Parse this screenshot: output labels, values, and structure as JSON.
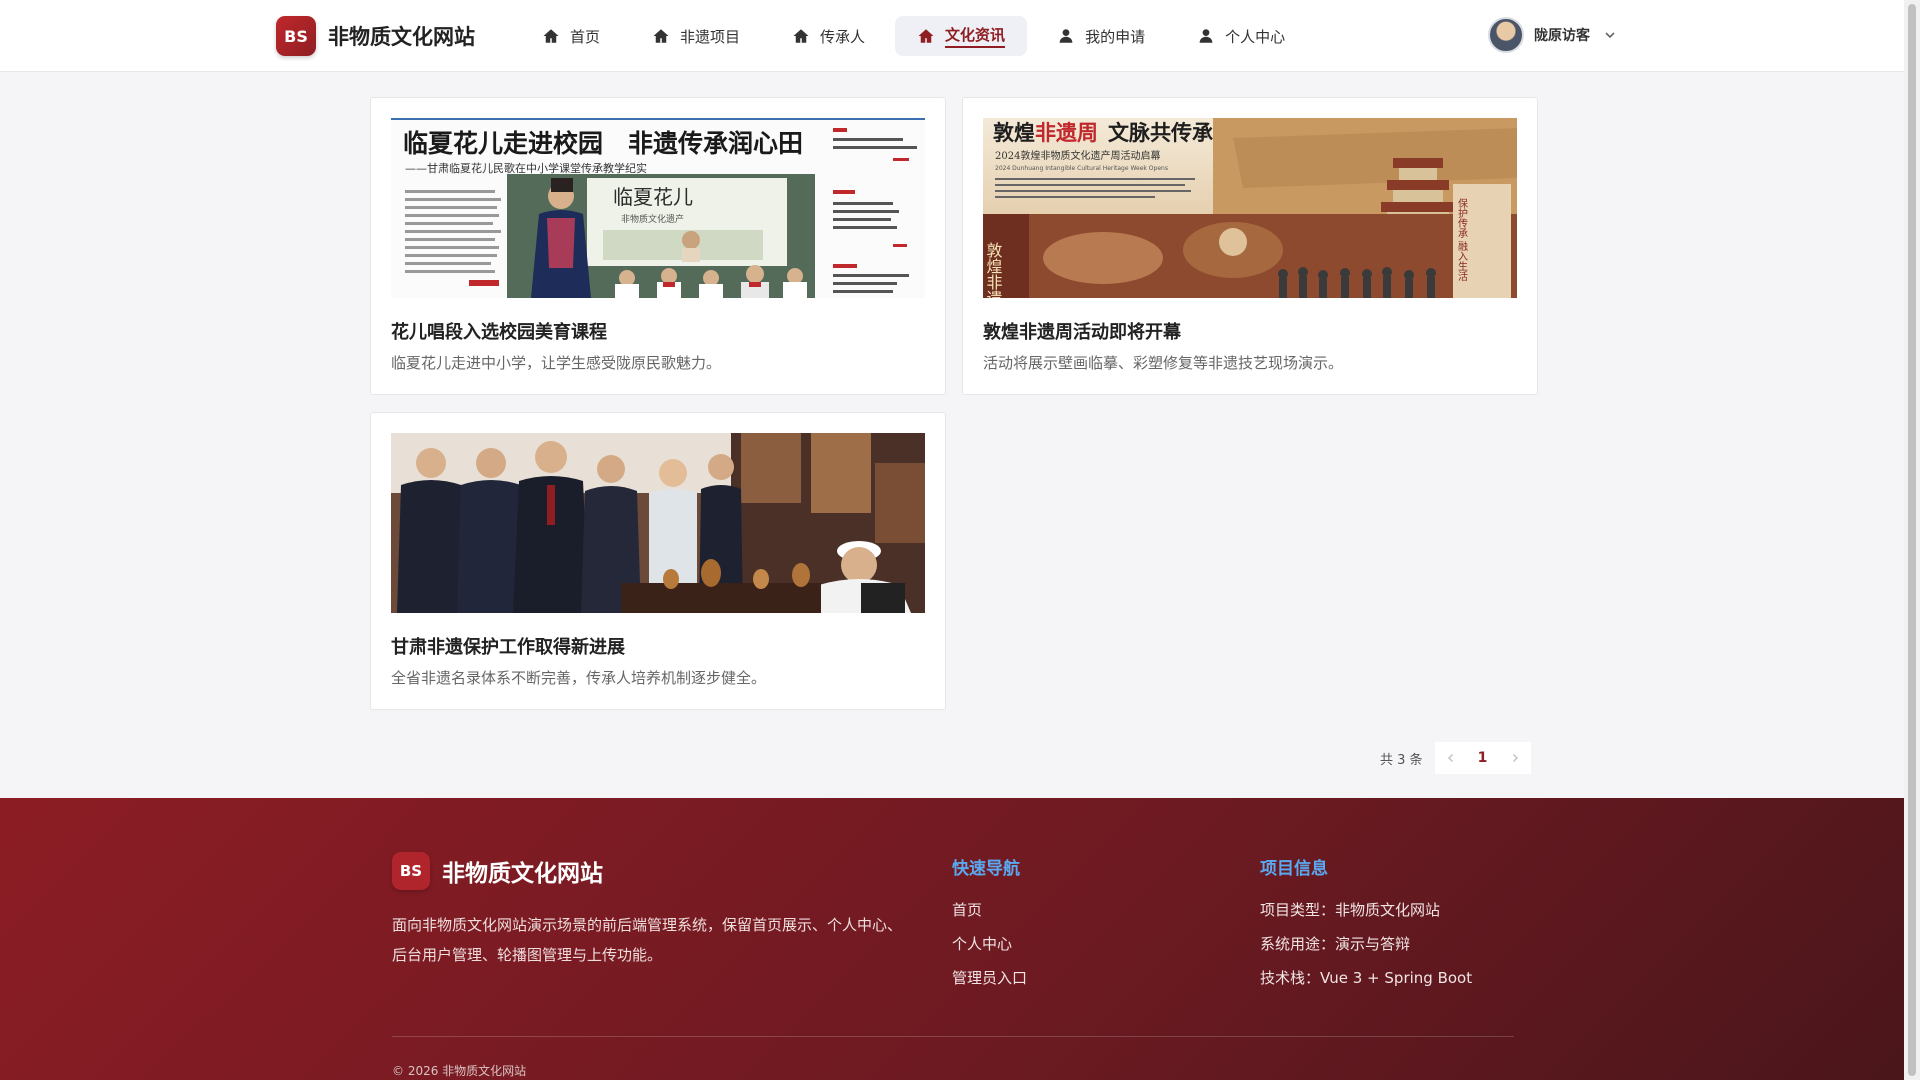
{
  "brand": {
    "badge": "BS",
    "name": "非物质文化网站",
    "accent": "#8e1e22"
  },
  "nav": {
    "items": [
      {
        "label": "首页",
        "icon": "home-icon",
        "active": false
      },
      {
        "label": "非遗项目",
        "icon": "home-icon",
        "active": false
      },
      {
        "label": "传承人",
        "icon": "home-icon",
        "active": false
      },
      {
        "label": "文化资讯",
        "icon": "home-icon",
        "active": true
      },
      {
        "label": "我的申请",
        "icon": "user-icon",
        "active": false
      },
      {
        "label": "个人中心",
        "icon": "user-icon",
        "active": false
      }
    ]
  },
  "user": {
    "name": "陇原访客",
    "icon": "chevron-down-icon"
  },
  "news": [
    {
      "title": "花儿唱段入选校园美育课程",
      "desc": "临夏花儿走进中小学，让学生感受陇原民歌魅力。",
      "image": {
        "headline": "临夏花儿走进校园　非遗传承润心田",
        "subheadline": "——甘肃临夏花儿民歌在中小学课堂传承教学纪实",
        "board_text": "临夏花儿",
        "board_sub": "非物质文化遗产"
      }
    },
    {
      "title": "敦煌非遗周活动即将开幕",
      "desc": "活动将展示壁画临摹、彩塑修复等非遗技艺现场演示。",
      "image": {
        "headline_prefix": "敦煌",
        "headline_highlight": "非遗周",
        "headline_suffix": "文脉共传承",
        "subheadline": "2024敦煌非物质文化遗产周活动启幕",
        "subheadline_en": "2024 Dunhuang Intangible Cultural Heritage Week Opens",
        "vertical_text": "敦煌非遗",
        "banner_text": "保护传承 融入生活"
      }
    },
    {
      "title": "甘肃非遗保护工作取得新进展",
      "desc": "全省非遗名录体系不断完善，传承人培养机制逐步健全。",
      "image": {}
    }
  ],
  "pagination": {
    "total": "共 3 条",
    "current": "1",
    "prev_icon": "chevron-left-icon",
    "next_icon": "chevron-right-icon"
  },
  "footer": {
    "badge": "BS",
    "name": "非物质文化网站",
    "desc": "面向非物质文化网站演示场景的前后端管理系统，保留首页展示、个人中心、后台用户管理、轮播图管理与上传功能。",
    "quick_nav": {
      "title": "快速导航",
      "links": [
        "首页",
        "个人中心",
        "管理员入口"
      ]
    },
    "project_info": {
      "title": "项目信息",
      "items": [
        "项目类型：非物质文化网站",
        "系统用途：演示与答辩",
        "技术栈：Vue 3 + Spring Boot"
      ]
    },
    "copyright": "© 2026 非物质文化网站",
    "heading_color": "#5aa9f0"
  }
}
